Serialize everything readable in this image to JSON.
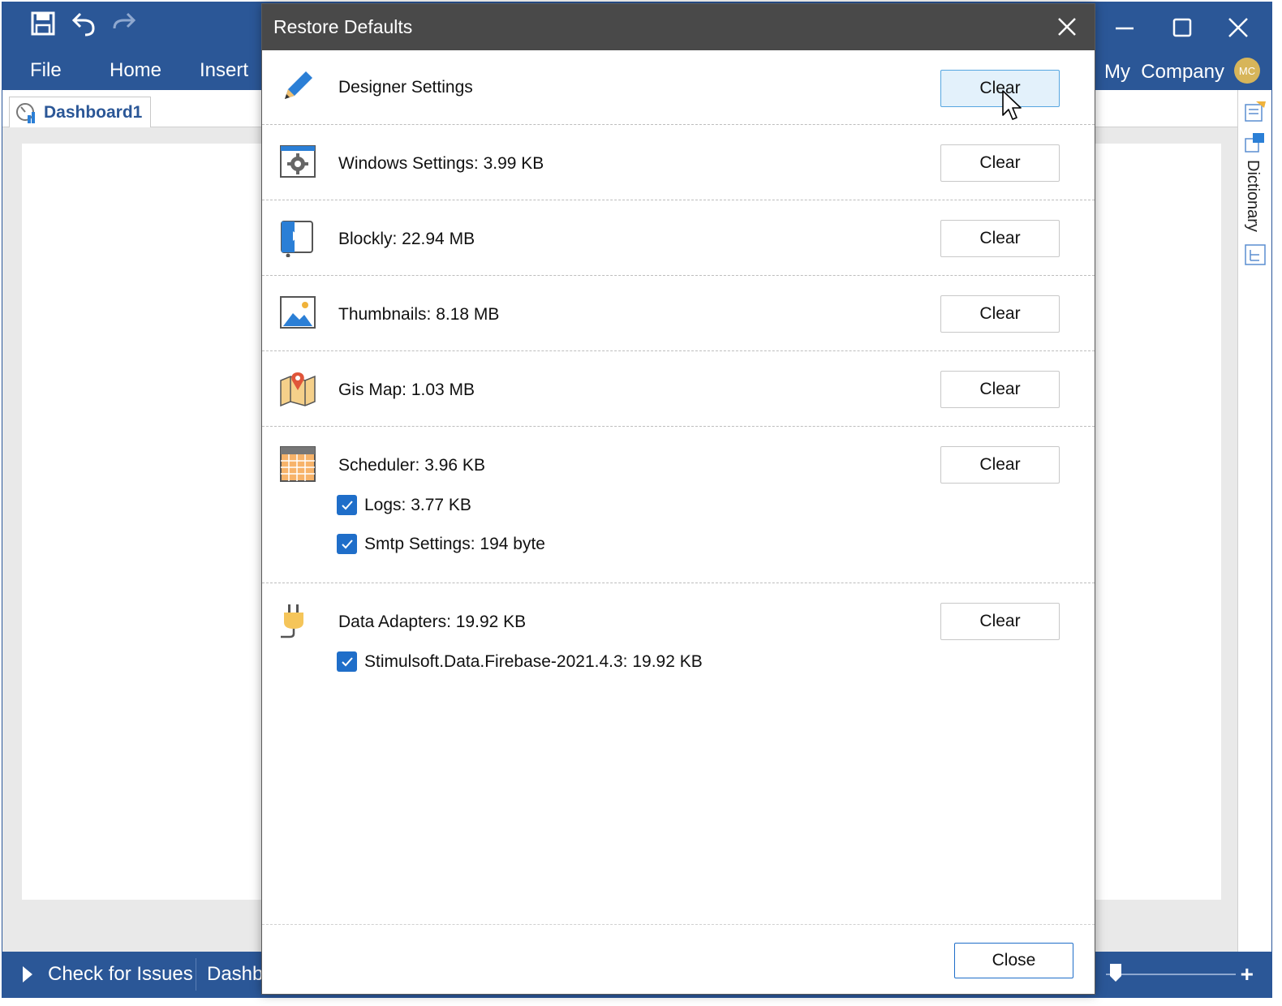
{
  "app": {
    "menu": [
      "File",
      "Home",
      "Insert"
    ],
    "company": "My  Company",
    "avatar_initials": "MC",
    "document_tab": "Dashboard1",
    "right_panel_label": "Dictionary",
    "status": {
      "check_for_issues": "Check for Issues",
      "page_name": "Dashb"
    }
  },
  "dialog": {
    "title": "Restore Defaults",
    "sections": [
      {
        "icon": "pencil-icon",
        "label": "Designer Settings",
        "button": "Clear",
        "hovered": true
      },
      {
        "icon": "window-settings-icon",
        "label": "Windows Settings: 3.99 KB",
        "button": "Clear"
      },
      {
        "icon": "blockly-icon",
        "label": "Blockly: 22.94 MB",
        "button": "Clear"
      },
      {
        "icon": "image-icon",
        "label": "Thumbnails: 8.18 MB",
        "button": "Clear"
      },
      {
        "icon": "map-icon",
        "label": "Gis Map: 1.03 MB",
        "button": "Clear"
      },
      {
        "icon": "calendar-icon",
        "label": "Scheduler: 3.96 KB",
        "button": "Clear",
        "subitems": [
          {
            "label": "Logs: 3.77 KB",
            "checked": true
          },
          {
            "label": "Smtp Settings: 194 byte",
            "checked": true
          }
        ]
      },
      {
        "icon": "plug-icon",
        "label": "Data Adapters: 19.92 KB",
        "button": "Clear",
        "subitems": [
          {
            "label": "Stimulsoft.Data.Firebase-2021.4.3: 19.92 KB",
            "checked": true
          }
        ]
      }
    ],
    "close_button": "Close"
  },
  "colors": {
    "titlebar": "#2b5797",
    "dialog_header": "#494949",
    "checkbox": "#1f6ec9",
    "hover_button": "#e3f1fb"
  }
}
